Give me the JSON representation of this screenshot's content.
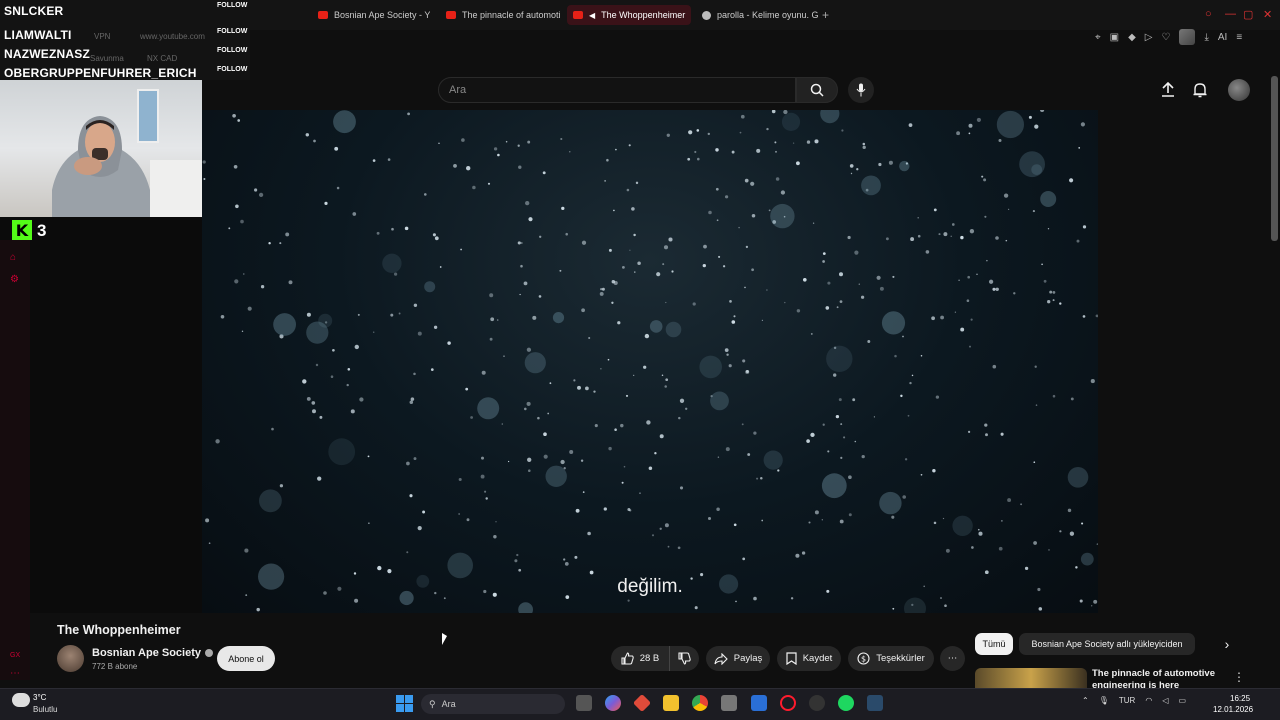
{
  "browser": {
    "tabs": [
      {
        "label": "Bosnian Ape Society - You"
      },
      {
        "label": "The pinnacle of automotiv"
      },
      {
        "label": "The Whoppenheimer"
      },
      {
        "label": "parolla - Kelime oyunu. Gü"
      }
    ],
    "toolbar_ai_label": "AI"
  },
  "youtube": {
    "search_placeholder": "Ara"
  },
  "video": {
    "subtitle": "değilim.",
    "title": "The Whoppenheimer",
    "channel_name": "Bosnian Ape Society",
    "subscriber_count": "772 B abone",
    "subscribe_label": "Abone ol",
    "like_count": "28 B",
    "share_label": "Paylaş",
    "save_label": "Kaydet",
    "thanks_label": "Teşekkürler"
  },
  "sidebar": {
    "chips": [
      "Tümü",
      "Bosnian Ape Society adlı yükleyiciden"
    ],
    "related": [
      {
        "title": "The pinnacle of automotive engineering is here"
      }
    ]
  },
  "stream_overlay": {
    "followers": [
      {
        "name": "SNLCKER",
        "action": "FOLLOW"
      },
      {
        "name": "LIAMWALTI",
        "action": "FOLLOW"
      },
      {
        "name": "NAZWEZNASZ",
        "action": "FOLLOW"
      },
      {
        "name": "OBERGRUPPENFUHRER_ERICH",
        "action": "FOLLOW"
      }
    ],
    "faded_text": [
      "VPN",
      "www.youtube.com",
      "Savunma",
      "NX CAD"
    ],
    "kick_count": "3",
    "side_tag": "GX"
  },
  "taskbar": {
    "weather_temp": "3°C",
    "weather_desc": "Bulutlu",
    "search_placeholder": "Ara",
    "language": "TUR",
    "time": "16:25",
    "date": "12.01.2026"
  }
}
